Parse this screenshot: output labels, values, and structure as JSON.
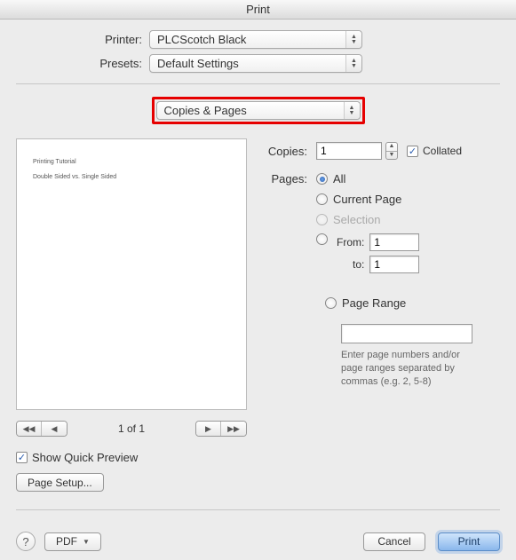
{
  "window": {
    "title": "Print"
  },
  "top": {
    "printer_label": "Printer:",
    "printer_value": "PLCScotch Black",
    "presets_label": "Presets:",
    "presets_value": "Default Settings"
  },
  "section": {
    "value": "Copies & Pages"
  },
  "preview": {
    "doc_line1": "Printing Tutorial",
    "doc_line2": "Double Sided vs. Single Sided",
    "page_indicator": "1 of 1",
    "show_quick_preview": "Show Quick Preview",
    "page_setup": "Page Setup..."
  },
  "copies": {
    "label": "Copies:",
    "value": "1",
    "collated": "Collated"
  },
  "pages": {
    "label": "Pages:",
    "all": "All",
    "current": "Current Page",
    "selection": "Selection",
    "from": "From:",
    "from_value": "1",
    "to": "to:",
    "to_value": "1",
    "range": "Page Range",
    "hint": "Enter page numbers and/or page ranges separated by commas (e.g. 2, 5-8)"
  },
  "footer": {
    "pdf": "PDF",
    "cancel": "Cancel",
    "print": "Print"
  }
}
